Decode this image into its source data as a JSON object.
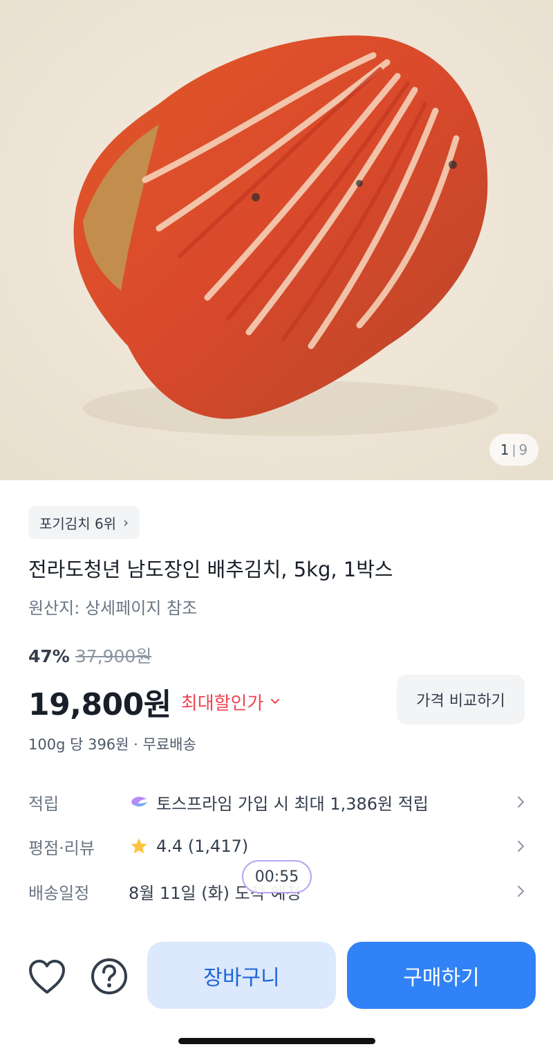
{
  "gallery": {
    "current": "1",
    "separator": "|",
    "total": "9"
  },
  "rank_chip": {
    "label": "포기김치 6위",
    "chevron": "›"
  },
  "product": {
    "title": "전라도청년 남도장인 배추김치, 5kg, 1박스",
    "origin": "원산지: 상세페이지 참조"
  },
  "pricing": {
    "discount_rate": "47%",
    "original_price": "37,900원",
    "price": "19,800원",
    "max_discount_label": "최대할인가",
    "compare_button": "가격 비교하기",
    "unit_price_shipping": "100g 당 396원 · 무료배송"
  },
  "info": {
    "points": {
      "label": "적립",
      "value": "토스프라임 가입 시 최대 1,386원 적립"
    },
    "rating": {
      "label": "평점·리뷰",
      "value": "4.4 (1,417)"
    },
    "delivery": {
      "label": "배송일정",
      "value": "8월 11일 (화) 도착 예정"
    }
  },
  "timer": "00:55",
  "bottom_bar": {
    "cart_label": "장바구니",
    "buy_label": "구매하기"
  },
  "colors": {
    "accent_blue": "#3182f6",
    "cart_bg": "#dce8fb",
    "discount_red": "#f04452",
    "star": "#ffc342"
  },
  "icons": [
    "heart-icon",
    "help-icon",
    "star-icon",
    "toss-prime-icon",
    "chevron-right-icon",
    "chevron-down-icon"
  ]
}
